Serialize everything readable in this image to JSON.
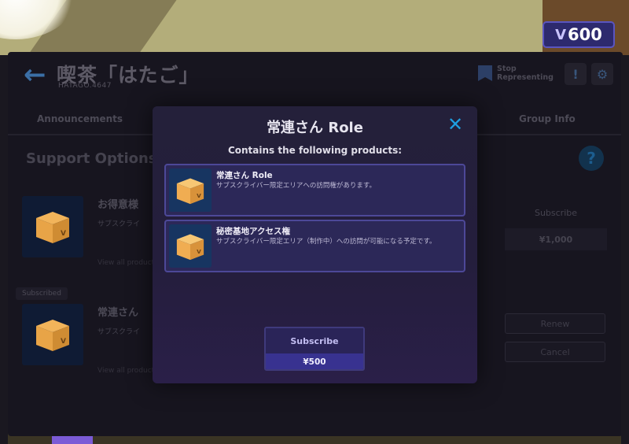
{
  "currency": {
    "symbol": "V",
    "amount": "600"
  },
  "group": {
    "name": "喫茶「はたご」",
    "id": "HATAGO.4647",
    "stop_representing": "Stop Representing",
    "report_icon": "!",
    "settings_icon": "⚙"
  },
  "tabs": [
    {
      "label": "Announcements"
    },
    {
      "label": "Group Info"
    }
  ],
  "support": {
    "title": "Support Options",
    "help_icon": "?"
  },
  "tiers": [
    {
      "name": "お得意様",
      "desc": "サブスクライ",
      "more": "View all products"
    },
    {
      "name": "常連さん",
      "desc": "サブスクライ",
      "more": "View all products"
    }
  ],
  "subscribed_tag": "Subscribed",
  "side": {
    "subscribe_label": "Subscribe",
    "subscribe_price": "¥1,000",
    "renew_label": "Renew",
    "cancel_label": "Cancel"
  },
  "modal": {
    "title": "常連さん Role",
    "close_icon": "✕",
    "subtitle": "Contains the following products:",
    "products": [
      {
        "name": "常連さん Role",
        "desc": "サブスクライバー限定エリアへの訪問権があります。"
      },
      {
        "name": "秘密基地アクセス権",
        "desc": "サブスクライバー限定エリア（制作中）への訪問が可能になる予定です。"
      }
    ],
    "subscribe_label": "Subscribe",
    "price": "¥500"
  },
  "colors": {
    "accent_blue": "#1e9fe0",
    "modal_bg": "#24203a",
    "product_border": "#4d4898",
    "box_orange": "#e8a447"
  }
}
